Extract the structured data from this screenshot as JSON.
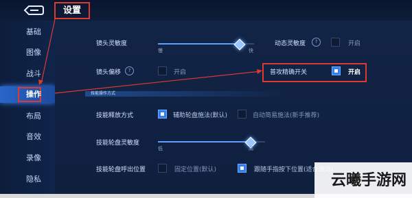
{
  "header": {
    "title": "设置"
  },
  "sidebar": {
    "items": [
      {
        "label": "基础"
      },
      {
        "label": "图像"
      },
      {
        "label": "战斗"
      },
      {
        "label": "操作",
        "active": true
      },
      {
        "label": "布局"
      },
      {
        "label": "音效"
      },
      {
        "label": "录像"
      },
      {
        "label": "隐私"
      }
    ]
  },
  "settings": {
    "camera_sensitivity": {
      "label": "镜头灵敏度",
      "min_label": "慢",
      "max_label": "快",
      "value_fraction": 0.84
    },
    "dynamic_sensitivity": {
      "label": "动态灵敏度",
      "option_label": "开启",
      "checked": false
    },
    "camera_offset": {
      "label": "镜头偏移",
      "option_label": "开启",
      "checked": false
    },
    "precise_attack": {
      "label": "普攻精确开关",
      "option_label": "开启",
      "checked": true
    },
    "skill_section": {
      "title": "技能操作方式"
    },
    "skill_release": {
      "label": "技能释放方式",
      "option1": "辅助轮盘施法(默认)",
      "option1_checked": true,
      "option2": "自动简易施法(新手推荐)",
      "option2_checked": false
    },
    "skill_wheel_sensitivity": {
      "label": "技能轮盘灵敏度",
      "min_label": "低",
      "max_label": "高",
      "value_fraction": 0.86
    },
    "skill_wheel_position": {
      "label": "技能轮盘呼出位置",
      "option1": "固定位置(默认)",
      "option1_checked": false,
      "option2": "跟随手指按下位置(适合滑动)",
      "option2_checked": true
    }
  },
  "watermark": {
    "text": "云曦手游网"
  },
  "colors": {
    "accent": "#2f7df2",
    "highlight": "#e03a2f",
    "background": "#0c1a33"
  }
}
